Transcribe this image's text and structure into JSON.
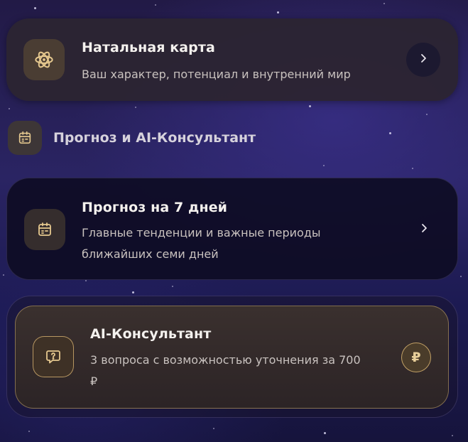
{
  "natal_card": {
    "title": "Натальная карта",
    "subtitle": "Ваш характер, потенциал и внутренний мир",
    "icon": "atom-icon",
    "action_icon": "chevron-right-icon"
  },
  "section": {
    "label": "Прогноз и AI-Консультант",
    "icon": "calendar-icon"
  },
  "forecast_card": {
    "title": "Прогноз на 7 дней",
    "subtitle_line1": "Главные тенденции и важные периоды",
    "subtitle_line2": "ближайших семи дней",
    "icon": "calendar-icon",
    "action_icon": "chevron-right-icon"
  },
  "ai_card": {
    "title": "AI-Консультант",
    "subtitle_line1": "3 вопроса с возможностью уточнения за 700",
    "subtitle_line2": "₽",
    "icon": "question-bubble-icon",
    "price_badge": "₽"
  },
  "colors": {
    "accent_gold": "#d6b270",
    "text_primary": "#f4f1ee",
    "text_secondary": "#c9c2bf"
  }
}
